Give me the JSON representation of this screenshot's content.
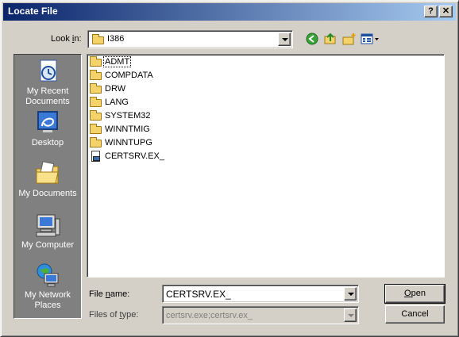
{
  "window": {
    "title": "Locate File",
    "help_button": "?",
    "close_button": "✕"
  },
  "look_in": {
    "label_prefix": "Look ",
    "label_accel": "i",
    "label_suffix": "n:",
    "value": "I386"
  },
  "toolbar": {
    "icons": [
      "back-icon",
      "up-folder-icon",
      "new-folder-icon",
      "views-menu-icon"
    ]
  },
  "places": [
    {
      "name": "recent",
      "line1": "My Recent",
      "line2": "Documents",
      "icon": "recent-documents-icon"
    },
    {
      "name": "desktop",
      "line1": "Desktop",
      "line2": "",
      "icon": "desktop-icon"
    },
    {
      "name": "documents",
      "line1": "My Documents",
      "line2": "",
      "icon": "my-documents-icon"
    },
    {
      "name": "computer",
      "line1": "My Computer",
      "line2": "",
      "icon": "my-computer-icon"
    },
    {
      "name": "network",
      "line1": "My Network",
      "line2": "Places",
      "icon": "network-places-icon"
    }
  ],
  "files": [
    {
      "name": "ADMT",
      "type": "folder"
    },
    {
      "name": "COMPDATA",
      "type": "folder"
    },
    {
      "name": "DRW",
      "type": "folder"
    },
    {
      "name": "LANG",
      "type": "folder"
    },
    {
      "name": "SYSTEM32",
      "type": "folder"
    },
    {
      "name": "WINNTMIG",
      "type": "folder"
    },
    {
      "name": "WINNTUPG",
      "type": "folder"
    },
    {
      "name": "CERTSRV.EX_",
      "type": "file"
    }
  ],
  "file_name": {
    "label_prefix": "File ",
    "label_accel": "n",
    "label_suffix": "ame:",
    "value": "CERTSRV.EX_"
  },
  "files_of_type": {
    "label_prefix": "Files of ",
    "label_accel": "t",
    "label_suffix": "ype:",
    "value": "certsrv.exe;certsrv.ex_"
  },
  "buttons": {
    "open_accel": "O",
    "open_rest": "pen",
    "cancel": "Cancel"
  }
}
